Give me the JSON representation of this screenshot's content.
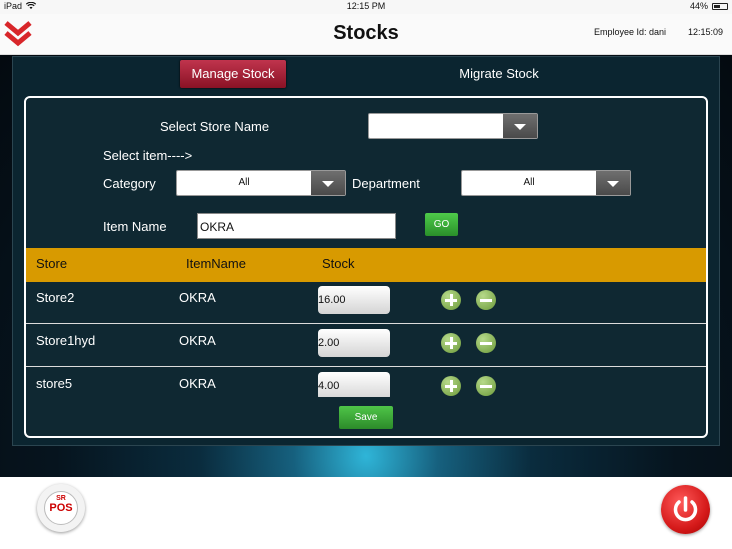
{
  "statusbar": {
    "device": "iPad",
    "time": "12:15 PM",
    "battery": "44%",
    "battery_level": 0.44
  },
  "header": {
    "title": "Stocks",
    "employee": "Employee Id: dani",
    "clock": "12:15:09"
  },
  "tabs": [
    {
      "label": "Manage Stock",
      "active": true
    },
    {
      "label": "Migrate Stock",
      "active": false
    }
  ],
  "form": {
    "store_label": "Select Store Name",
    "store_value": "",
    "select_item_label": "Select item---->",
    "category_label": "Category",
    "category_value": "All",
    "department_label": "Department",
    "department_value": "All",
    "item_name_label": "Item Name",
    "item_name_value": "OKRA",
    "go_label": "GO"
  },
  "table": {
    "headers": [
      "Store",
      "ItemName",
      "Stock"
    ],
    "rows": [
      {
        "store": "Store2",
        "item": "OKRA",
        "stock": "16.00"
      },
      {
        "store": "Store1hyd",
        "item": "OKRA",
        "stock": "2.00"
      },
      {
        "store": "store5",
        "item": "OKRA",
        "stock": "4.00"
      }
    ]
  },
  "save_label": "Save",
  "footer": {
    "logo_top": "SR",
    "logo_main": "POS"
  },
  "colors": {
    "table_header": "#d89a00",
    "accent_red": "#c0344d",
    "button_green": "#3aa83a"
  }
}
